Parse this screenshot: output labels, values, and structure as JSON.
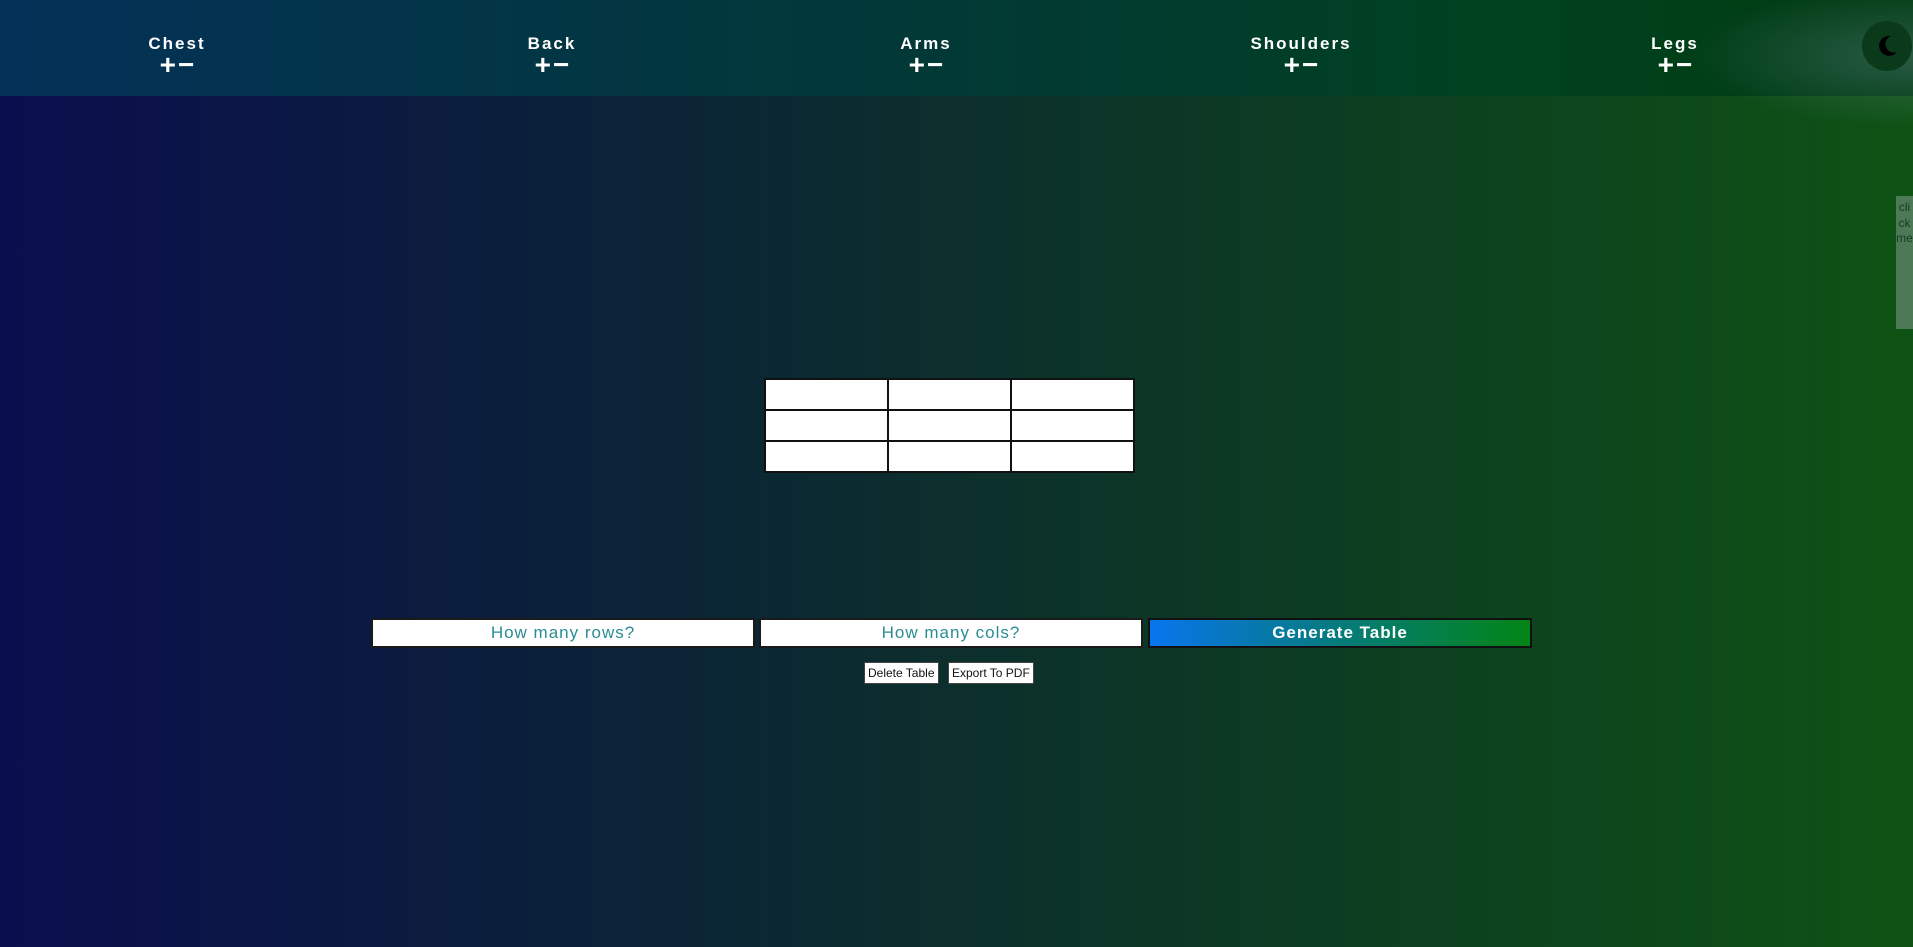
{
  "nav": {
    "items": [
      {
        "label": "Chest",
        "plus": "+",
        "minus": "−"
      },
      {
        "label": "Back",
        "plus": "+",
        "minus": "−"
      },
      {
        "label": "Arms",
        "plus": "+",
        "minus": "−"
      },
      {
        "label": "Shoulders",
        "plus": "+",
        "minus": "−"
      },
      {
        "label": "Legs",
        "plus": "+",
        "minus": "−"
      }
    ]
  },
  "theme_toggle": {
    "icon": "moon-icon"
  },
  "side_tab": {
    "text": "click me"
  },
  "table": {
    "rows": 3,
    "cols": 3,
    "cells": [
      [
        "",
        "",
        ""
      ],
      [
        "",
        "",
        ""
      ],
      [
        "",
        "",
        ""
      ]
    ]
  },
  "form": {
    "rows_placeholder": "How many rows?",
    "rows_value": "",
    "cols_placeholder": "How many cols?",
    "cols_value": "",
    "generate_label": "Generate Table",
    "delete_label": "Delete Table",
    "export_label": "Export To PDF"
  },
  "colors": {
    "placeholder_text": "#2a8d92",
    "generate_gradient_start": "#0875ee",
    "generate_gradient_end": "#028416"
  }
}
